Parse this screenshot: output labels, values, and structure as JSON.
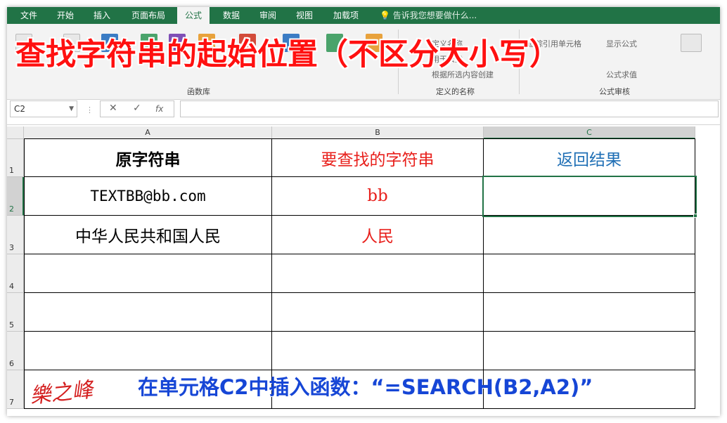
{
  "ribbon": {
    "tabs": [
      {
        "label": "文件",
        "active": false
      },
      {
        "label": "开始",
        "active": false
      },
      {
        "label": "插入",
        "active": false
      },
      {
        "label": "页面布局",
        "active": false
      },
      {
        "label": "公式",
        "active": true
      },
      {
        "label": "数据",
        "active": false
      },
      {
        "label": "审阅",
        "active": false
      },
      {
        "label": "视图",
        "active": false
      },
      {
        "label": "加载项",
        "active": false
      }
    ],
    "tell_me": "告诉我您想要做什么...",
    "group_function_library": "函数库",
    "group_defined_names": "定义的名称",
    "group_formula_auditing": "公式审核",
    "defined_names_items": [
      "定义名称",
      "用于公式",
      "根据所选内容创建"
    ],
    "auditing_items": [
      "追踪引用单元格",
      "显示公式",
      "公式求值"
    ],
    "accent_color": "#217346"
  },
  "overlay_title": "查找字符串的起始位置（不区分大小写）",
  "formula_bar": {
    "name_box": "C2",
    "cancel_icon": "✕",
    "enter_icon": "✓",
    "fx_icon": "fx",
    "formula": ""
  },
  "sheet": {
    "columns": [
      "A",
      "B",
      "C"
    ],
    "selected_column": "C",
    "rows": [
      "1",
      "2",
      "3",
      "4",
      "5",
      "6",
      "7"
    ],
    "selected_row": "2",
    "selected_cell": "C2",
    "header": {
      "a": "原字符串",
      "b": "要查找的字符串",
      "c": "返回结果"
    },
    "row2": {
      "a": "TEXTBB@bb.com",
      "b": "bb",
      "c": ""
    },
    "row3": {
      "a": "中华人民共和国人民",
      "b": "人民",
      "c": ""
    },
    "colors": {
      "header_b": "#e8201c",
      "header_c": "#1f6fb5",
      "value_b": "#e8201c"
    }
  },
  "bottom_caption": "在单元格C2中插入函数：“=SEARCH(B2,A2)”",
  "signature": "樂之峰"
}
